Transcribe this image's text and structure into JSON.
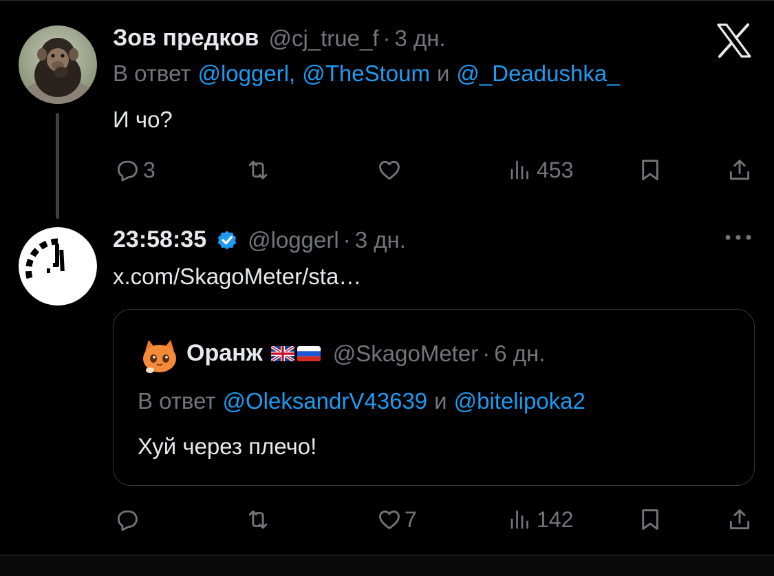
{
  "tweet1": {
    "author_name": "Зов предков",
    "handle": "@cj_true_f",
    "separator": "·",
    "time": "3 дн.",
    "reply_prefix": "В ответ",
    "reply_to": [
      {
        "text": "@loggerl,"
      },
      {
        "text": "@TheStoum"
      },
      {
        "text": "@_Deadushka_"
      }
    ],
    "reply_and": "и",
    "text": "И чо?",
    "actions": {
      "replies": "3",
      "reposts": "",
      "likes": "",
      "views": "453"
    }
  },
  "tweet2": {
    "author_name": "23:58:35",
    "verified": true,
    "handle": "@loggerl",
    "separator": "·",
    "time": "3 дн.",
    "link_text": "x.com/SkagoMeter/sta…",
    "quote": {
      "author_name": "Оранж",
      "flags": "🇬🇧🇷🇺",
      "handle": "@SkagoMeter",
      "separator": "·",
      "time": "6 дн.",
      "reply_prefix": "В ответ",
      "reply_to": [
        {
          "text": "@OleksandrV43639"
        },
        {
          "text": "@bitelipoka2"
        }
      ],
      "reply_and": "и",
      "text": "Хуй через плечо!"
    },
    "actions": {
      "replies": "",
      "reposts": "",
      "likes": "7",
      "views": "142"
    }
  },
  "icons": {
    "logo": "x-logo-icon",
    "more": "more-dots-icon",
    "reply": "reply-icon",
    "repost": "repost-icon",
    "like": "heart-icon",
    "views": "views-icon",
    "bookmark": "bookmark-icon",
    "share": "share-icon",
    "verified": "verified-badge-icon"
  },
  "colors": {
    "background": "#000000",
    "text": "#e7e9ea",
    "secondary": "#71767b",
    "link": "#1d9bf0",
    "border": "#333639"
  }
}
